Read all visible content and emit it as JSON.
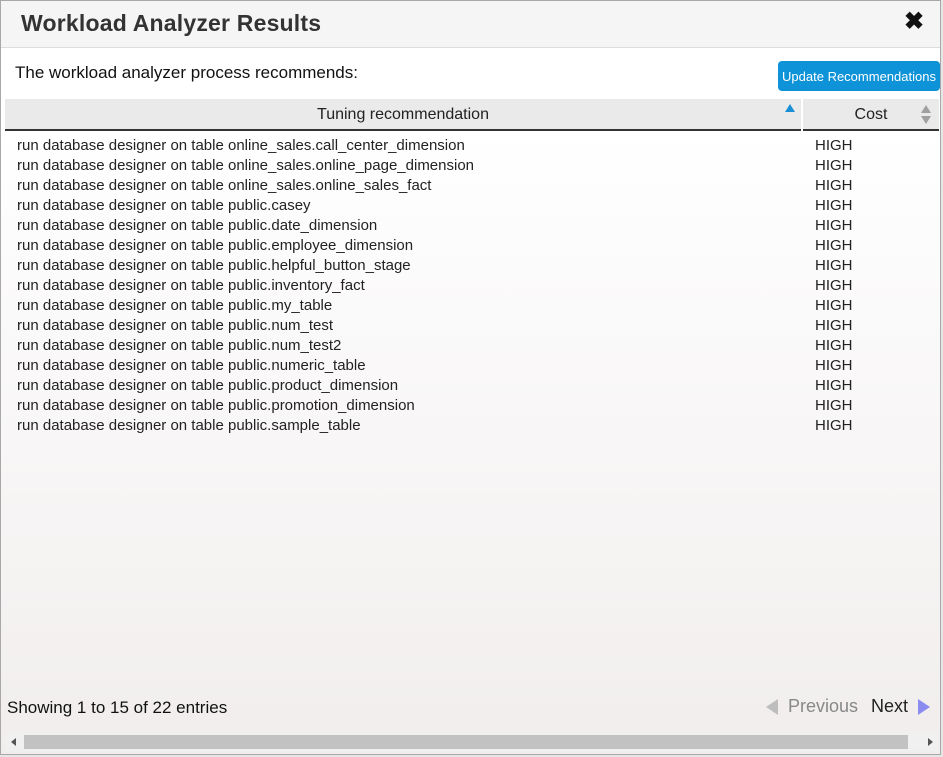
{
  "dialog": {
    "title": "Workload Analyzer Results",
    "close_icon": "✖"
  },
  "intro_text": "The workload analyzer process recommends:",
  "update_button_label": "Update Recommendations",
  "table": {
    "columns": [
      "Tuning recommendation",
      "Cost"
    ],
    "sort": {
      "column": "Tuning recommendation",
      "direction": "ascending"
    },
    "rows": [
      {
        "recommendation": "run database designer on table online_sales.call_center_dimension",
        "cost": "HIGH"
      },
      {
        "recommendation": "run database designer on table online_sales.online_page_dimension",
        "cost": "HIGH"
      },
      {
        "recommendation": "run database designer on table online_sales.online_sales_fact",
        "cost": "HIGH"
      },
      {
        "recommendation": "run database designer on table public.casey",
        "cost": "HIGH"
      },
      {
        "recommendation": "run database designer on table public.date_dimension",
        "cost": "HIGH"
      },
      {
        "recommendation": "run database designer on table public.employee_dimension",
        "cost": "HIGH"
      },
      {
        "recommendation": "run database designer on table public.helpful_button_stage",
        "cost": "HIGH"
      },
      {
        "recommendation": "run database designer on table public.inventory_fact",
        "cost": "HIGH"
      },
      {
        "recommendation": "run database designer on table public.my_table",
        "cost": "HIGH"
      },
      {
        "recommendation": "run database designer on table public.num_test",
        "cost": "HIGH"
      },
      {
        "recommendation": "run database designer on table public.num_test2",
        "cost": "HIGH"
      },
      {
        "recommendation": "run database designer on table public.numeric_table",
        "cost": "HIGH"
      },
      {
        "recommendation": "run database designer on table public.product_dimension",
        "cost": "HIGH"
      },
      {
        "recommendation": "run database designer on table public.promotion_dimension",
        "cost": "HIGH"
      },
      {
        "recommendation": "run database designer on table public.sample_table",
        "cost": "HIGH"
      }
    ]
  },
  "footer": {
    "info": "Showing 1 to 15 of 22 entries",
    "previous_label": "Previous",
    "next_label": "Next"
  },
  "colors": {
    "accent": "#0e92d8",
    "sort_indicator": "#1a8fd6",
    "next_arrow": "#8c8cf0"
  },
  "icons": {
    "close": "close-icon",
    "sort_asc": "sort-ascending-icon",
    "sort_both": "sort-both-icon",
    "prev": "arrow-left-icon",
    "next": "arrow-right-icon"
  }
}
